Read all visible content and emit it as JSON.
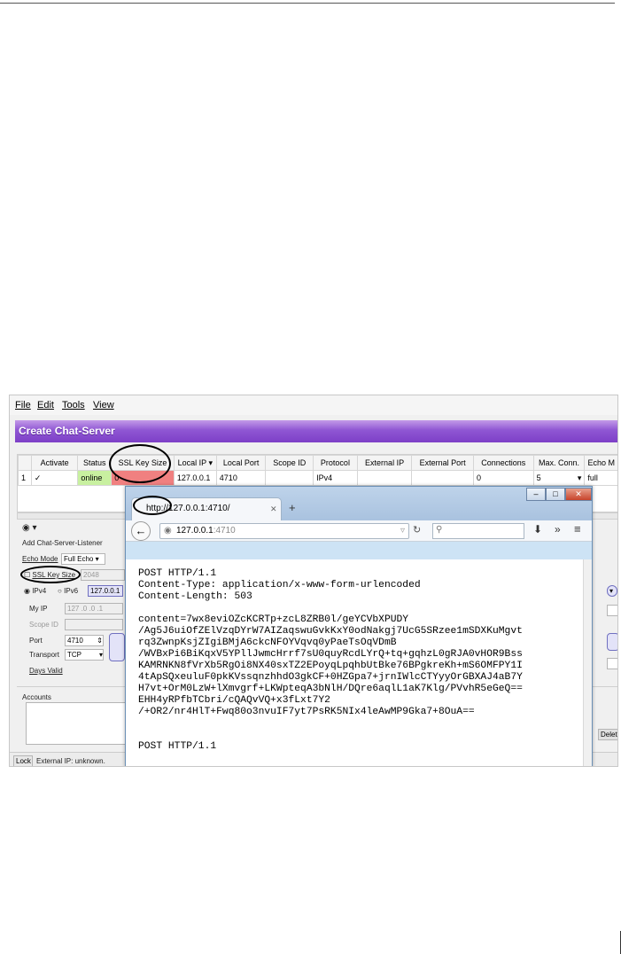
{
  "menu": [
    "File",
    "Edit",
    "Tools",
    "View"
  ],
  "header_title": "Create Chat-Server",
  "table": {
    "columns": [
      "Activate",
      "Status",
      "SSL Key Size",
      "Local IP",
      "Local Port",
      "Scope ID",
      "Protocol",
      "External IP",
      "External Port",
      "Connections",
      "Max. Conn.",
      "Echo M"
    ],
    "row": {
      "num": "1",
      "check": "✓",
      "status": "online",
      "ssl": "0",
      "local_ip": "127.0.0.1",
      "local_port": "4710",
      "scope": "",
      "protocol": "IPv4",
      "ext_ip": "",
      "ext_port": "",
      "connections": "0",
      "max_conn": "5",
      "echo": "full"
    }
  },
  "panel": {
    "listener_title": "Add Chat-Server-Listener",
    "echo_mode_label": "Echo Mode",
    "echo_mode_value": "Full Echo",
    "ssl_label": "SSL Key Size",
    "ssl_value": "2048",
    "ipv4": "IPv4",
    "ipv6": "IPv6",
    "ip_value": "127.0.0.1",
    "my_ip_label": "My IP",
    "my_ip_value": "127 .0 .0 .1",
    "scope_label": "Scope ID",
    "port_label": "Port",
    "port_value": "4710",
    "transport_label": "Transport",
    "transport_value": "TCP",
    "days_label": "Days Valid",
    "accounts_label": "Accounts",
    "delete_label": "Delete"
  },
  "statusbar": {
    "lock": "Lock",
    "external_ip": "External IP: unknown."
  },
  "browser": {
    "tab_title": "http://127.0.0.1:4710/",
    "url_host": "127.0.0.1",
    "url_port": ":4710",
    "body": "POST HTTP/1.1\nContent-Type: application/x-www-form-urlencoded\nContent-Length: 503\n\ncontent=7wx8eviOZcKCRTp+zcL8ZRB0l/geYCVbXPUDY\n/Ag5J6uiOfZElVzqDYrW7AIZaqswuGvkKxY0odNakgj7UcG5SRzee1mSDXKuMgvt\nrq3ZwnpKsjZIgiBMjA6ckcNFOYVqvq0yPaeTsOqVDmB\n/WVBxPi6BiKqxV5YPllJwmcHrrf7sU0quyRcdLYrQ+tq+gqhzL0gRJA0vHOR9Bss\nKAMRNKN8fVrXb5RgOi8NX40sxTZ2EPoyqLpqhbUtBke76BPgkreKh+mS6OMFPY1I\n4tApSQxeuluF0pkKVssqnzhhdO3gkCF+0HZGpa7+jrnIWlcCTYyyOrGBXAJ4aB7Y\nH7vt+OrM0LzW+lXmvgrf+LKWpteqA3bNlH/DQre6aqlL1aK7Klg/PVvhR5eGeQ==\nEHH4yRPfbTCbri/cQAQvVQ+x3fLxt7Y2\n/+OR2/nr4HlT+Fwq80o3nvuIF7yt7PsRK5NIx4leAwMP9Gka7+8OuA==\n\n\nPOST HTTP/1.1"
  },
  "colors": {
    "header": "#7d3fc7",
    "ssl_cell": "#f08080",
    "status_cell": "#c8f0a0"
  }
}
